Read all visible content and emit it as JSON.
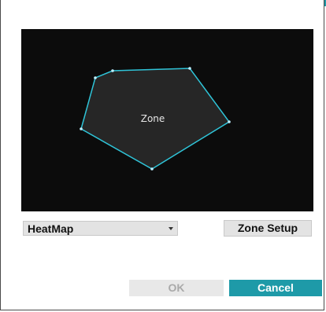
{
  "preview": {
    "zone_label": "Zone"
  },
  "controls": {
    "mode_select_value": "HeatMap",
    "zone_setup_label": "Zone Setup"
  },
  "footer": {
    "ok_label": "OK",
    "cancel_label": "Cancel"
  },
  "colors": {
    "accent": "#1e9aa8",
    "zone_outline": "#2fc4d8",
    "zone_fill": "#262626",
    "preview_bg": "#0c0c0c"
  },
  "icons": {
    "select_arrow": "chevron-down-icon"
  }
}
